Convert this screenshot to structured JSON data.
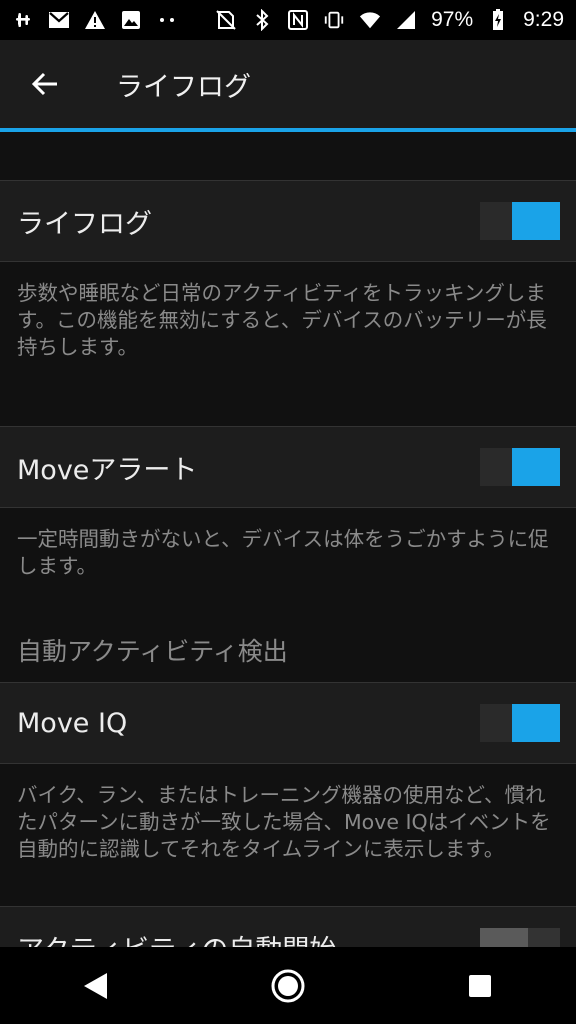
{
  "status_bar": {
    "battery_percent": "97%",
    "time": "9:29",
    "left_icons": [
      "slack-icon",
      "gmail-icon",
      "warning-icon",
      "image-icon",
      "more-dots-icon"
    ],
    "right_icons": [
      "no-sim-icon",
      "bluetooth-icon",
      "nfc-icon",
      "vibrate-icon",
      "wifi-icon",
      "signal-icon",
      "battery-icon"
    ]
  },
  "app_bar": {
    "title": "ライフログ"
  },
  "settings": [
    {
      "label": "ライフログ",
      "on": true,
      "description": "歩数や睡眠など日常のアクティビティをトラッキングします。この機能を無効にすると、デバイスのバッテリーが長持ちします。"
    },
    {
      "label": "Moveアラート",
      "on": true,
      "description": "一定時間動きがないと、デバイスは体をうごかすように促します。"
    },
    {
      "label": "Move IQ",
      "on": true,
      "description": "バイク、ラン、またはトレーニング機器の使用など、慣れたパターンに動きが一致した場合、Move IQはイベントを自動的に認識してそれをタイムラインに表示します。"
    },
    {
      "label": "アクティビティの自動開始",
      "on": false
    }
  ],
  "section_header": "自動アクティビティ検出",
  "colors": {
    "accent": "#1aa3e8",
    "background": "#111111",
    "row": "#1d1d1d"
  }
}
